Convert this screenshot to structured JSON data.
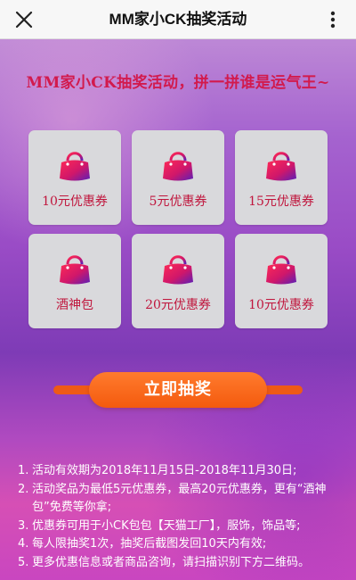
{
  "topbar": {
    "title": "MM家小CK抽奖活动",
    "close_icon": "close-icon",
    "more_icon": "more-dots-icon"
  },
  "headline": "MM家小CK抽奖活动，拼一拼谁是运气王~",
  "prizes": [
    {
      "label": "10元优惠券",
      "icon": "handbag-icon"
    },
    {
      "label": "5元优惠券",
      "icon": "handbag-icon"
    },
    {
      "label": "15元优惠券",
      "icon": "handbag-icon"
    },
    {
      "label": "酒神包",
      "icon": "handbag-icon"
    },
    {
      "label": "20元优惠券",
      "icon": "handbag-icon"
    },
    {
      "label": "10元优惠券",
      "icon": "handbag-icon"
    }
  ],
  "draw_button": "立即抽奖",
  "rules": [
    {
      "num": "1.",
      "text": "活动有效期为2018年11月15日-2018年11月30日;"
    },
    {
      "num": "2.",
      "text": "活动奖品为最低5元优惠券，最高20元优惠券，更有“酒神包”免费等你拿;"
    },
    {
      "num": "3.",
      "text": "优惠券可用于小CK包包【天猫工厂】，服饰，饰品等;"
    },
    {
      "num": "4.",
      "text": "每人限抽奖1次，抽奖后截图发回10天内有效;"
    },
    {
      "num": "5.",
      "text": "更多优惠信息或者商品咨询，请扫描识别下方二维码。"
    }
  ],
  "colors": {
    "accent_red": "#c0163d",
    "button_orange": "#f45a0e",
    "cell_gray": "#d9d9dc"
  }
}
